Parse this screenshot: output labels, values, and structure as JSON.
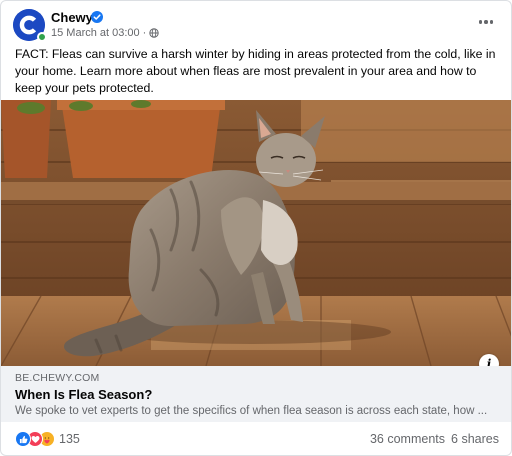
{
  "post": {
    "page_name": "Chewy",
    "date": "15 March at 03:00",
    "separator": "·",
    "body": "FACT: Fleas can survive a harsh winter by hiding in areas protected from the cold, like in your home. Learn more about when fleas are most prevalent in your area and how to keep your pets protected."
  },
  "link": {
    "domain": "BE.CHEWY.COM",
    "title": "When Is Flea Season?",
    "description": "We spoke to vet experts to get the specifics of when flea season is across each state, how ..."
  },
  "footer": {
    "reaction_count": "135",
    "comments": "36 comments",
    "shares": "6 shares"
  },
  "icons": {
    "verified": "verified-badge-icon",
    "audience": "globe-icon",
    "more": "more-options-icon",
    "info": "info-icon",
    "reactions": [
      "like-icon",
      "love-icon",
      "care-icon"
    ]
  },
  "colors": {
    "brand": "#1c49c2",
    "verified": "#1877f2",
    "like": "#1877f2",
    "love": "#f33e58",
    "care": "#f7b125",
    "link_preview_bg": "#f0f2f5",
    "secondary_text": "#65676b"
  }
}
